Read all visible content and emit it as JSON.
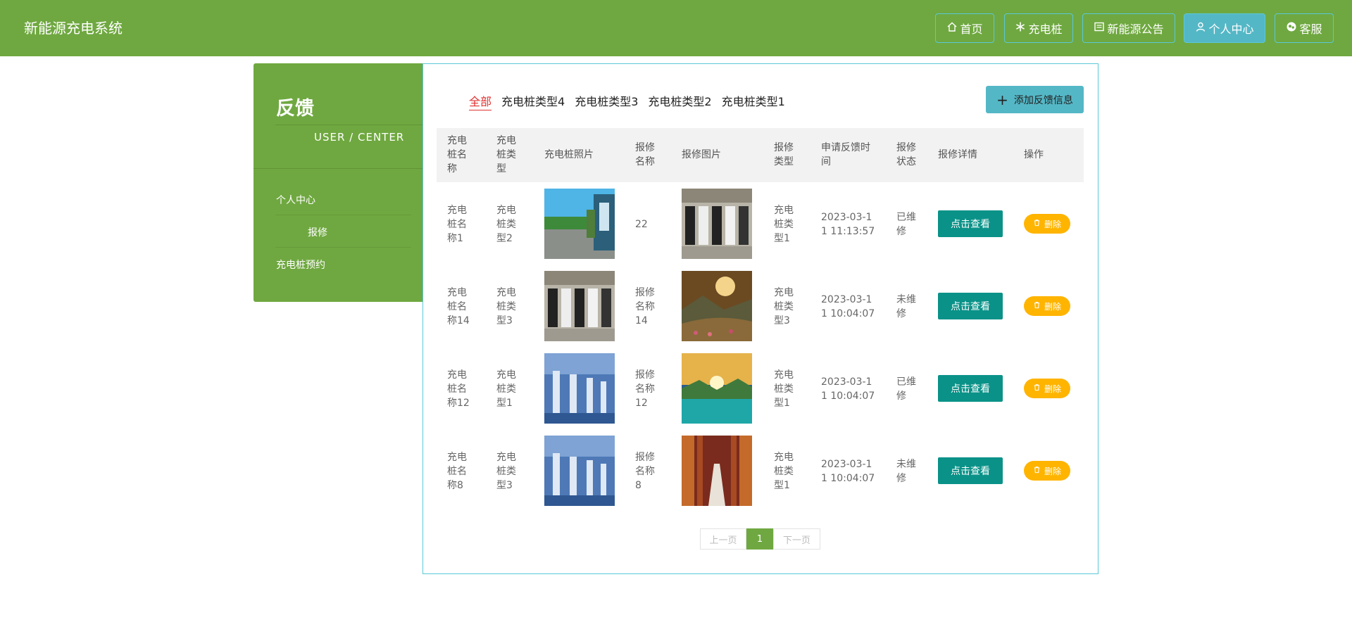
{
  "header": {
    "brand": "新能源充电系统",
    "nav": [
      {
        "label": "首页",
        "icon": "home-icon",
        "active": false
      },
      {
        "label": "充电桩",
        "icon": "snowflake-icon",
        "active": false
      },
      {
        "label": "新能源公告",
        "icon": "notice-icon",
        "active": false
      },
      {
        "label": "个人中心",
        "icon": "user-icon",
        "active": true
      },
      {
        "label": "客服",
        "icon": "chat-icon",
        "active": false
      }
    ]
  },
  "sidebar": {
    "title": "反馈",
    "subtitle": "USER / CENTER",
    "items": [
      {
        "label": "个人中心"
      },
      {
        "label": "报修"
      },
      {
        "label": "充电桩预约"
      }
    ]
  },
  "tabs": [
    "全部",
    "充电桩类型4",
    "充电桩类型3",
    "充电桩类型2",
    "充电桩类型1"
  ],
  "active_tab": "全部",
  "add_button": "添加反馈信息",
  "table": {
    "columns": [
      "充电桩名称",
      "充电桩类型",
      "充电桩照片",
      "报修名称",
      "报修图片",
      "报修类型",
      "申请反馈时间",
      "报修状态",
      "报修详情",
      "操作"
    ],
    "rows": [
      {
        "name": "充电桩名称1",
        "type": "充电桩类型2",
        "photo": "charger-photo-outdoor",
        "repair_name": "22",
        "repair_image": "charger-row-photo",
        "repair_type": "充电桩类型1",
        "time": "2023-03-11 11:13:57",
        "status": "已维修"
      },
      {
        "name": "充电桩名称14",
        "type": "充电桩类型3",
        "photo": "charger-row-photo",
        "repair_name": "报修名称14",
        "repair_image": "mountain-sunset-photo",
        "repair_type": "充电桩类型3",
        "time": "2023-03-11 10:04:07",
        "status": "未维修"
      },
      {
        "name": "充电桩名称12",
        "type": "充电桩类型1",
        "photo": "charger-blue-photo",
        "repair_name": "报修名称12",
        "repair_image": "lake-sunrise-photo",
        "repair_type": "充电桩类型1",
        "time": "2023-03-11 10:04:07",
        "status": "已维修"
      },
      {
        "name": "充电桩名称8",
        "type": "充电桩类型3",
        "photo": "charger-blue-photo",
        "repair_name": "报修名称8",
        "repair_image": "corridor-photo",
        "repair_type": "充电桩类型1",
        "time": "2023-03-11 10:04:07",
        "status": "未维修"
      }
    ],
    "view_label": "点击查看",
    "delete_label": "删除"
  },
  "pagination": {
    "prev": "上一页",
    "current": "1",
    "next": "下一页"
  },
  "colors": {
    "header_bg": "#6fa840",
    "accent_cyan": "#54b7c6",
    "view_btn": "#0a9288",
    "delete_btn": "#ffb400",
    "active_tab": "#e03030"
  }
}
